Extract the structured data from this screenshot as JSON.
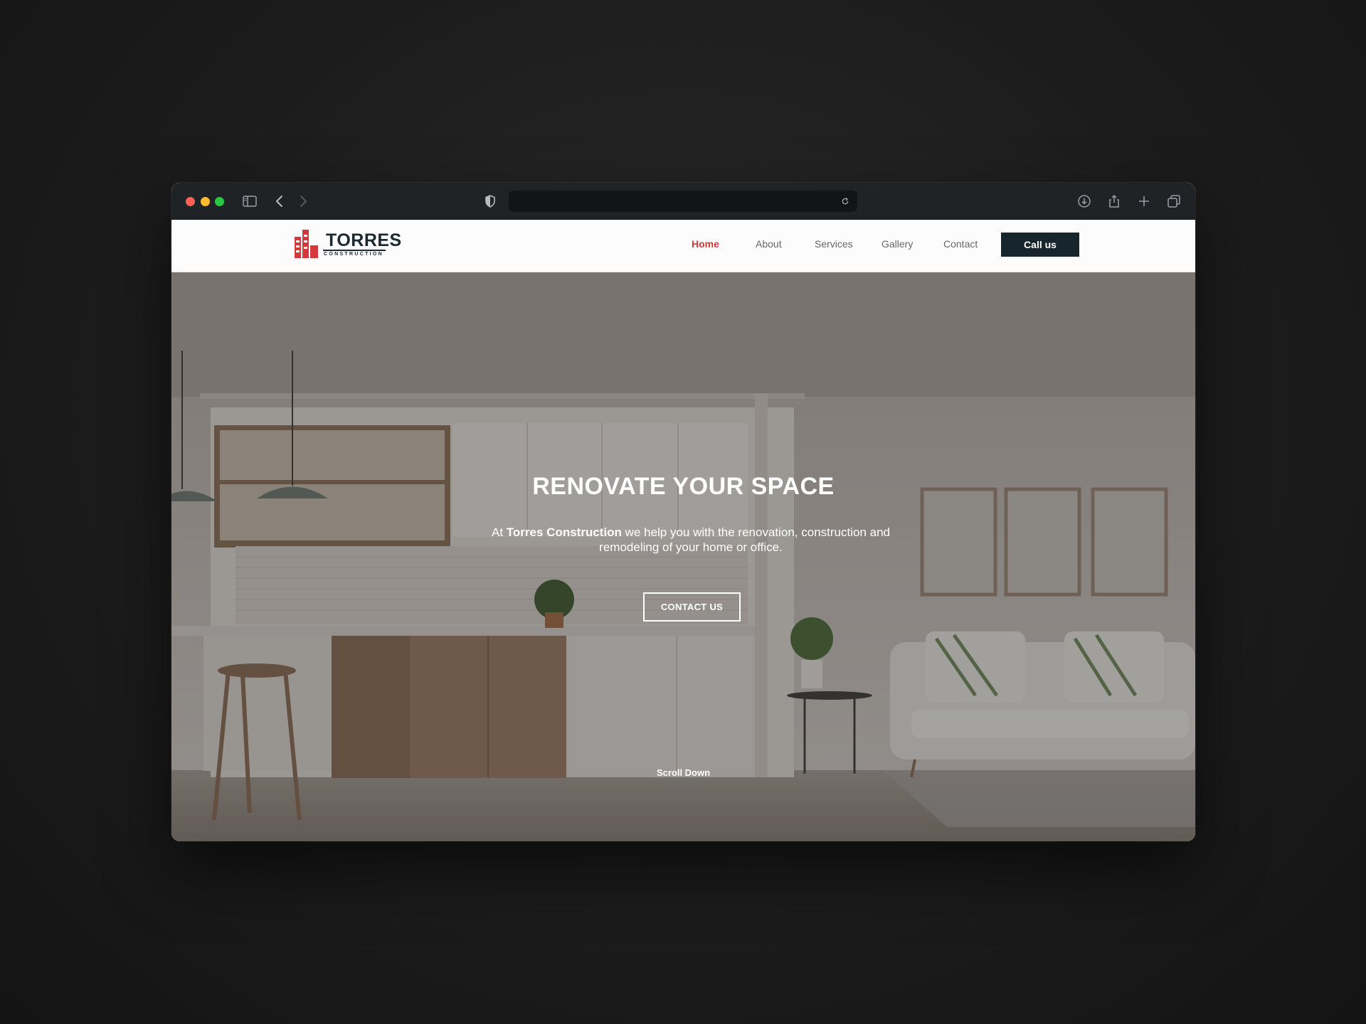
{
  "browser": {
    "url": "",
    "icons": [
      "sidebar-icon",
      "back-icon",
      "forward-icon",
      "shield-icon",
      "reload-icon",
      "download-icon",
      "share-icon",
      "new-tab-icon",
      "tabs-overview-icon"
    ]
  },
  "brand": {
    "name": "TORRES",
    "tagline": "CONSTRUCTION",
    "accent_color": "#d6373b",
    "dark_color": "#17252c"
  },
  "nav": {
    "items": [
      {
        "label": "Home",
        "active": true
      },
      {
        "label": "About",
        "active": false
      },
      {
        "label": "Services",
        "active": false
      },
      {
        "label": "Gallery",
        "active": false
      },
      {
        "label": "Contact",
        "active": false
      }
    ],
    "cta_label": "Call us"
  },
  "hero": {
    "title": "RENOVATE YOUR SPACE",
    "text_prefix": "At ",
    "text_company": "Torres Construction",
    "text_suffix": " we help you with the renovation, construction and remodeling of your home or office.",
    "button_label": "CONTACT US",
    "scroll_label": "Scroll Down"
  }
}
